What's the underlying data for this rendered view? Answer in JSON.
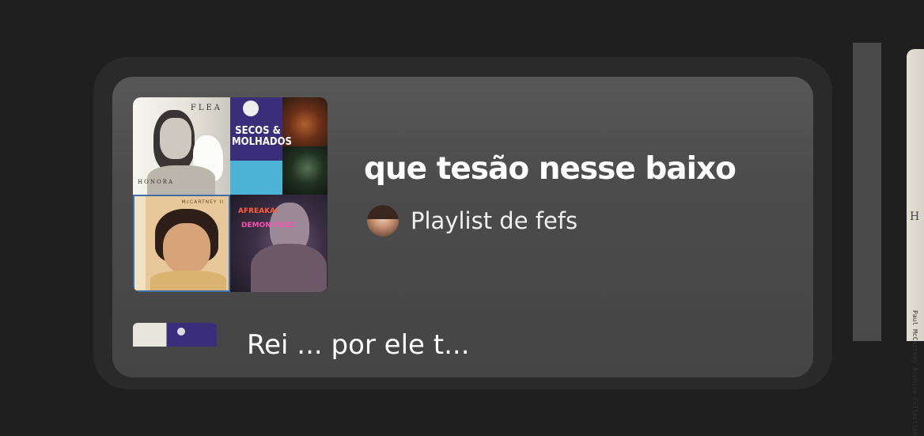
{
  "playlist": {
    "title": "que tesão nesse baixo",
    "meta": "Playlist de fefs"
  },
  "cover_tiles": {
    "flea": {
      "title": "FLEA",
      "subtitle": "HONORA"
    },
    "secos": {
      "title": "SECOS & MOLHADOS"
    },
    "mccartney": {
      "label": "McCARTNEY II"
    },
    "afreaka": {
      "title": "AFREAKA!",
      "subtitle": "DEMON FUZZ"
    }
  },
  "next_item": {
    "title": "Rei ... por ele t..."
  },
  "right_panel": {
    "edge_h": "H",
    "edge_text": "Paul McCartney Archive Collection"
  },
  "colors": {
    "page_bg": "#1f1f1f",
    "panel_bg": "#2a2a2a",
    "card_bg": "#4c4c4c",
    "text": "#ffffff"
  }
}
